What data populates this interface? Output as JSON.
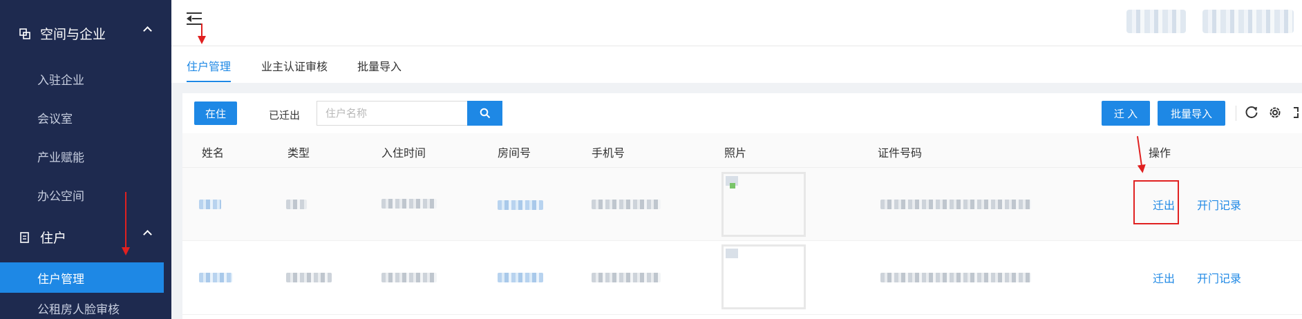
{
  "sidebar": {
    "groups": [
      {
        "label": "空间与企业",
        "icon": "layers-icon",
        "items": [
          "入驻企业",
          "会议室",
          "产业赋能",
          "办公空间"
        ]
      },
      {
        "label": "住户",
        "icon": "document-icon",
        "items": [
          "住户管理",
          "公租房人脸审核"
        ]
      }
    ],
    "active_item": "住户管理"
  },
  "header": {
    "menu_icon": "menu-fold-icon"
  },
  "tabs": [
    "住户管理",
    "业主认证审核",
    "批量导入"
  ],
  "toolbar": {
    "filter_active": "在住",
    "filter_other": "已迁出",
    "search_placeholder": "住户名称",
    "move_in": "迁 入",
    "batch_import": "批量导入",
    "icons": [
      "refresh-icon",
      "settings-icon",
      "fullscreen-icon"
    ]
  },
  "table": {
    "columns": [
      "姓名",
      "类型",
      "入住时间",
      "房间号",
      "手机号",
      "照片",
      "证件号码",
      "操作"
    ],
    "rows": [
      {
        "actions": [
          "迁出",
          "开门记录"
        ]
      },
      {
        "actions": [
          "迁出",
          "开门记录"
        ]
      }
    ]
  },
  "colors": {
    "sidebar_bg": "#1e2a4f",
    "primary": "#1e88e5",
    "annotation": "#e02020"
  }
}
